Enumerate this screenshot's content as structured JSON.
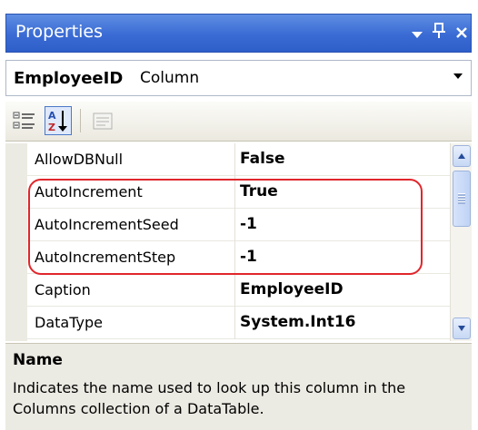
{
  "window": {
    "title": "Properties",
    "buttons": {
      "dropdown_icon": "triangle-down-icon",
      "pin_icon": "pin-icon",
      "close_icon": "close-icon"
    }
  },
  "object_selector": {
    "name": "EmployeeID",
    "type": "Column"
  },
  "toolbar": {
    "buttons": [
      {
        "name": "categorized-icon",
        "selected": false
      },
      {
        "name": "alphabetical-icon",
        "selected": true
      },
      {
        "name": "property-pages-icon",
        "selected": false
      }
    ]
  },
  "properties": [
    {
      "name": "AllowDBNull",
      "value": "False"
    },
    {
      "name": "AutoIncrement",
      "value": "True"
    },
    {
      "name": "AutoIncrementSeed",
      "value": "-1"
    },
    {
      "name": "AutoIncrementStep",
      "value": "-1"
    },
    {
      "name": "Caption",
      "value": "EmployeeID"
    },
    {
      "name": "DataType",
      "value": "System.Int16"
    }
  ],
  "description": {
    "title": "Name",
    "text": "Indicates the name used to look up this column in the Columns collection of a DataTable."
  },
  "colors": {
    "titlebar": "#3a6bd4",
    "highlight": "#e0262b",
    "selected_button_border": "#4b79c9"
  }
}
